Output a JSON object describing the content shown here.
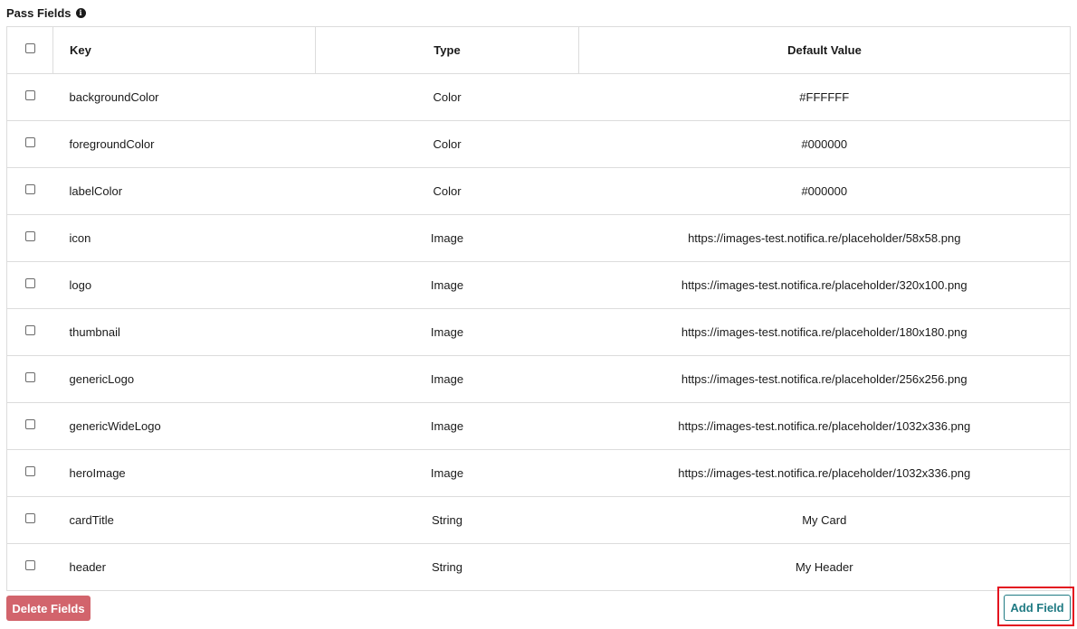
{
  "section": {
    "title": "Pass Fields",
    "info_icon": "i"
  },
  "table": {
    "headers": {
      "key": "Key",
      "type": "Type",
      "default_value": "Default Value"
    },
    "rows": [
      {
        "key": "backgroundColor",
        "type": "Color",
        "default_value": "#FFFFFF"
      },
      {
        "key": "foregroundColor",
        "type": "Color",
        "default_value": "#000000"
      },
      {
        "key": "labelColor",
        "type": "Color",
        "default_value": "#000000"
      },
      {
        "key": "icon",
        "type": "Image",
        "default_value": "https://images-test.notifica.re/placeholder/58x58.png"
      },
      {
        "key": "logo",
        "type": "Image",
        "default_value": "https://images-test.notifica.re/placeholder/320x100.png"
      },
      {
        "key": "thumbnail",
        "type": "Image",
        "default_value": "https://images-test.notifica.re/placeholder/180x180.png"
      },
      {
        "key": "genericLogo",
        "type": "Image",
        "default_value": "https://images-test.notifica.re/placeholder/256x256.png"
      },
      {
        "key": "genericWideLogo",
        "type": "Image",
        "default_value": "https://images-test.notifica.re/placeholder/1032x336.png"
      },
      {
        "key": "heroImage",
        "type": "Image",
        "default_value": "https://images-test.notifica.re/placeholder/1032x336.png"
      },
      {
        "key": "cardTitle",
        "type": "String",
        "default_value": "My Card"
      },
      {
        "key": "header",
        "type": "String",
        "default_value": "My Header"
      }
    ]
  },
  "actions": {
    "delete_label": "Delete Fields",
    "add_label": "Add Field"
  },
  "colors": {
    "delete_button": "#d2646c",
    "add_button_accent": "#1f7a83",
    "highlight": "#e3121f",
    "border": "#dcdcdc"
  }
}
